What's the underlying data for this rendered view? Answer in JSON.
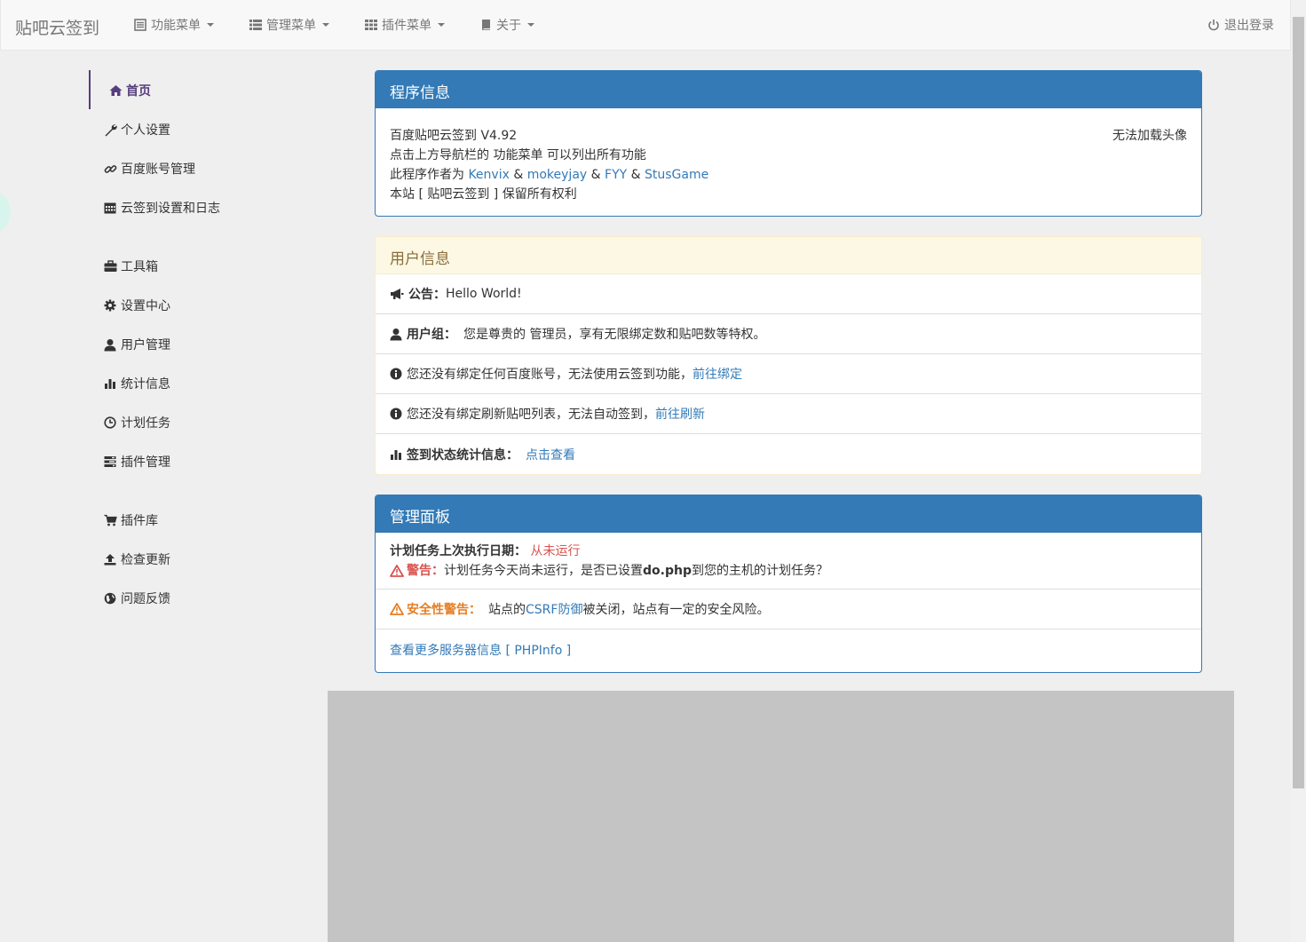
{
  "navbar": {
    "brand": "贴吧云签到",
    "menus": [
      {
        "label": "功能菜单",
        "icon": "list-icon"
      },
      {
        "label": "管理菜单",
        "icon": "th-list-icon"
      },
      {
        "label": "插件菜单",
        "icon": "th-icon"
      },
      {
        "label": "关于",
        "icon": "book-icon"
      }
    ],
    "logout": "退出登录"
  },
  "sidebar": {
    "items": [
      {
        "label": "首页",
        "icon": "home-icon",
        "active": true
      },
      {
        "label": "个人设置",
        "icon": "wrench-icon"
      },
      {
        "label": "百度账号管理",
        "icon": "link-icon"
      },
      {
        "label": "云签到设置和日志",
        "icon": "calendar-icon"
      },
      {
        "label": "工具箱",
        "icon": "briefcase-icon"
      },
      {
        "label": "设置中心",
        "icon": "cog-icon"
      },
      {
        "label": "用户管理",
        "icon": "user-icon"
      },
      {
        "label": "统计信息",
        "icon": "stats-icon"
      },
      {
        "label": "计划任务",
        "icon": "clock-icon"
      },
      {
        "label": "插件管理",
        "icon": "tasks-icon"
      },
      {
        "label": "插件库",
        "icon": "cart-icon"
      },
      {
        "label": "检查更新",
        "icon": "upload-icon"
      },
      {
        "label": "问题反馈",
        "icon": "globe-icon"
      }
    ]
  },
  "program_info": {
    "title": "程序信息",
    "line1": "百度贴吧云签到 V4.92",
    "line2": "点击上方导航栏的 功能菜单 可以列出所有功能",
    "line3_prefix": "此程序作者为 ",
    "authors": [
      "Kenvix",
      "mokeyjay",
      "FYY",
      "StusGame"
    ],
    "amp": " & ",
    "line4": "本站 [ 贴吧云签到 ] 保留所有权利",
    "avatar_text": "无法加载头像"
  },
  "user_info": {
    "title": "用户信息",
    "notice_label": "公告：",
    "notice_text": "Hello World!",
    "group_label": "用户组：",
    "group_text": "您是尊贵的 管理员，享有无限绑定数和贴吧数等特权。",
    "bind_text": "您还没有绑定任何百度账号，无法使用云签到功能，",
    "bind_link": "前往绑定",
    "refresh_text": "您还没有绑定刷新贴吧列表，无法自动签到，",
    "refresh_link": "前往刷新",
    "stats_label": "签到状态统计信息：",
    "stats_link": "点击查看"
  },
  "admin_panel": {
    "title": "管理面板",
    "cron_label": "计划任务上次执行日期：",
    "cron_value": "从未运行",
    "warn_label": "警告：",
    "warn_text_1": "计划任务今天尚未运行，是否已设置 ",
    "warn_text_bold": "do.php",
    "warn_text_2": " 到您的主机的计划任务？",
    "sec_label": "安全性警告：",
    "sec_text_1": "站点的",
    "sec_link": "CSRF防御",
    "sec_text_2": "被关闭，站点有一定的安全风险。",
    "more_link": "查看更多服务器信息 [ PHPInfo ]"
  },
  "colors": {
    "primary": "#337ab7",
    "active": "#563d7c",
    "warning_bg": "#fcf8e3",
    "danger": "#d9534f",
    "orange": "#e67e22"
  }
}
